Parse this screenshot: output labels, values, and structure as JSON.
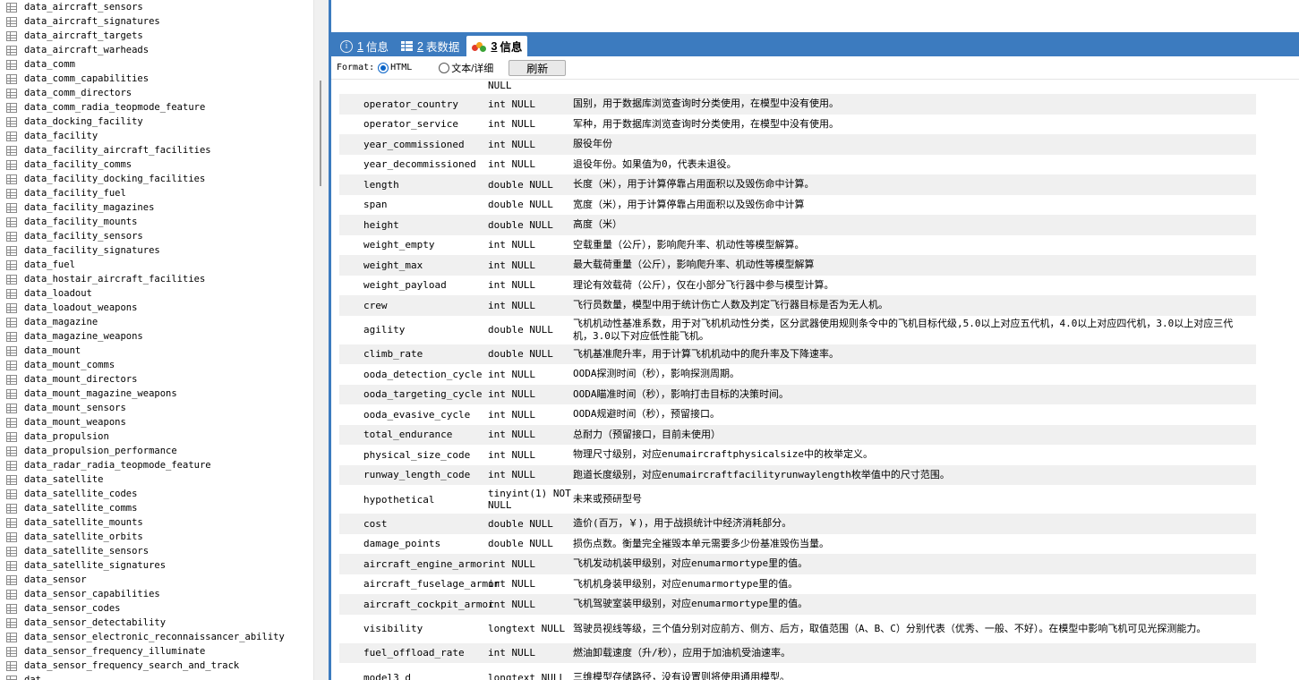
{
  "tree": [
    "data_aircraft_sensors",
    "data_aircraft_signatures",
    "data_aircraft_targets",
    "data_aircraft_warheads",
    "data_comm",
    "data_comm_capabilities",
    "data_comm_directors",
    "data_comm_radia_teopmode_feature",
    "data_docking_facility",
    "data_facility",
    "data_facility_aircraft_facilities",
    "data_facility_comms",
    "data_facility_docking_facilities",
    "data_facility_fuel",
    "data_facility_magazines",
    "data_facility_mounts",
    "data_facility_sensors",
    "data_facility_signatures",
    "data_fuel",
    "data_hostair_aircraft_facilities",
    "data_loadout",
    "data_loadout_weapons",
    "data_magazine",
    "data_magazine_weapons",
    "data_mount",
    "data_mount_comms",
    "data_mount_directors",
    "data_mount_magazine_weapons",
    "data_mount_sensors",
    "data_mount_weapons",
    "data_propulsion",
    "data_propulsion_performance",
    "data_radar_radia_teopmode_feature",
    "data_satellite",
    "data_satellite_codes",
    "data_satellite_comms",
    "data_satellite_mounts",
    "data_satellite_orbits",
    "data_satellite_sensors",
    "data_satellite_signatures",
    "data_sensor",
    "data_sensor_capabilities",
    "data_sensor_codes",
    "data_sensor_detectability",
    "data_sensor_electronic_reconnaissancer_ability",
    "data_sensor_frequency_illuminate",
    "data_sensor_frequency_search_and_track",
    "dat"
  ],
  "tabs": [
    {
      "num": "1",
      "label": "信息"
    },
    {
      "num": "2",
      "label": "表数据"
    },
    {
      "num": "3",
      "label": "信息"
    }
  ],
  "toolbar": {
    "format_label": "Format:",
    "opt_html": "HTML",
    "opt_text": "文本/详细",
    "refresh": "刷新"
  },
  "rows": [
    {
      "name": "",
      "type": "NULL",
      "desc": ""
    },
    {
      "name": "operator_country",
      "type": "int NULL",
      "desc": "国别，用于数据库浏览查询时分类使用，在模型中没有使用。"
    },
    {
      "name": "operator_service",
      "type": "int NULL",
      "desc": "军种，用于数据库浏览查询时分类使用，在模型中没有使用。"
    },
    {
      "name": "year_commissioned",
      "type": "int NULL",
      "desc": "服役年份"
    },
    {
      "name": "year_decommissioned",
      "type": "int NULL",
      "desc": "退役年份。如果值为0，代表未退役。"
    },
    {
      "name": "length",
      "type": "double NULL",
      "desc": "长度（米），用于计算停靠占用面积以及毁伤命中计算。"
    },
    {
      "name": "span",
      "type": "double NULL",
      "desc": "宽度（米），用于计算停靠占用面积以及毁伤命中计算"
    },
    {
      "name": "height",
      "type": "double NULL",
      "desc": "高度（米）"
    },
    {
      "name": "weight_empty",
      "type": "int NULL",
      "desc": "空载重量（公斤），影响爬升率、机动性等模型解算。"
    },
    {
      "name": "weight_max",
      "type": "int NULL",
      "desc": "最大载荷重量（公斤），影响爬升率、机动性等模型解算"
    },
    {
      "name": "weight_payload",
      "type": "int NULL",
      "desc": "理论有效载荷（公斤），仅在小部分飞行器中参与模型计算。"
    },
    {
      "name": "crew",
      "type": "int NULL",
      "desc": "飞行员数量，模型中用于统计伤亡人数及判定飞行器目标是否为无人机。"
    },
    {
      "name": "agility",
      "type": "double NULL",
      "desc": "飞机机动性基准系数，用于对飞机机动性分类，区分武器使用规则条令中的飞机目标代级,5.0以上对应五代机，4.0以上对应四代机，3.0以上对应三代机，3.0以下对应低性能飞机。"
    },
    {
      "name": "climb_rate",
      "type": "double NULL",
      "desc": "飞机基准爬升率，用于计算飞机机动中的爬升率及下降速率。"
    },
    {
      "name": "ooda_detection_cycle",
      "type": "int NULL",
      "desc": "OODA探测时间（秒），影响探测周期。"
    },
    {
      "name": "ooda_targeting_cycle",
      "type": "int NULL",
      "desc": "OODA瞄准时间（秒），影响打击目标的决策时间。"
    },
    {
      "name": "ooda_evasive_cycle",
      "type": "int NULL",
      "desc": "OODA规避时间（秒），预留接口。"
    },
    {
      "name": "total_endurance",
      "type": "int NULL",
      "desc": "总耐力（预留接口，目前未使用）"
    },
    {
      "name": "physical_size_code",
      "type": "int NULL",
      "desc": "物理尺寸级别，对应enumaircraftphysicalsize中的枚举定义。"
    },
    {
      "name": "runway_length_code",
      "type": "int NULL",
      "desc": "跑道长度级别，对应enumaircraftfacilityrunwaylength枚举值中的尺寸范围。"
    },
    {
      "name": "hypothetical",
      "type": "tinyint(1) NOT NULL",
      "desc": "未来或预研型号"
    },
    {
      "name": "cost",
      "type": "double NULL",
      "desc": "造价(百万，￥)，用于战损统计中经济消耗部分。"
    },
    {
      "name": "damage_points",
      "type": "double NULL",
      "desc": "损伤点数。衡量完全摧毁本单元需要多少份基准毁伤当量。"
    },
    {
      "name": "aircraft_engine_armor",
      "type": "int NULL",
      "desc": "飞机发动机装甲级别，对应enumarmortype里的值。"
    },
    {
      "name": "aircraft_fuselage_armor",
      "type": "int NULL",
      "desc": "飞机机身装甲级别，对应enumarmortype里的值。"
    },
    {
      "name": "aircraft_cockpit_armor",
      "type": "int NULL",
      "desc": "飞机驾驶室装甲级别，对应enumarmortype里的值。"
    },
    {
      "name": "visibility",
      "type": "longtext NULL",
      "desc": "驾驶员视线等级，三个值分别对应前方、侧方、后方，取值范围（A、B、C）分别代表（优秀、一般、不好）。在模型中影响飞机可见光探测能力。"
    },
    {
      "name": "fuel_offload_rate",
      "type": "int NULL",
      "desc": "燃油卸载速度（升/秒），应用于加油机受油速率。"
    },
    {
      "name": "model3_d",
      "type": "longtext NULL",
      "desc": "三维模型存储路径，没有设置则将使用通用模型。"
    }
  ]
}
